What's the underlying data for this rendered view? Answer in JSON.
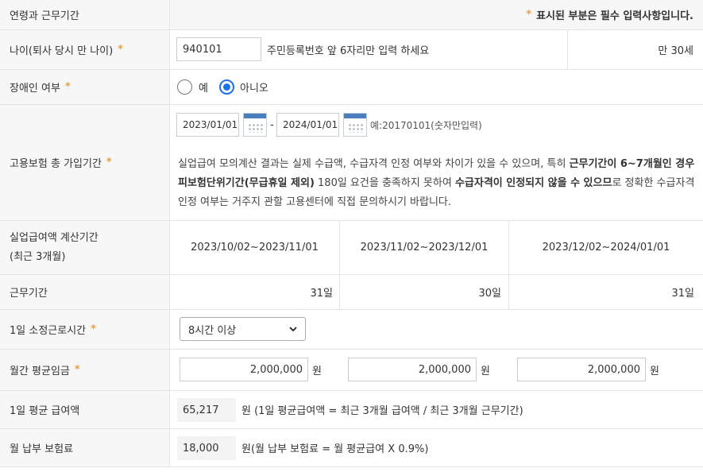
{
  "header": {
    "title": "연령과 근무기간",
    "required_note": "표시된 부분은 필수 입력사항입니다.",
    "star": "*"
  },
  "age": {
    "label": "나이(퇴사 당시 만 나이)",
    "value": "940101",
    "hint": "주민등록번호 앞 6자리만 입력 하세요",
    "result": "만 30세"
  },
  "disabled": {
    "label": "장애인 여부",
    "option_yes": "예",
    "option_no": "아니오",
    "selected": "아니오"
  },
  "insurance": {
    "label": "고용보험 총 가입기간",
    "start": "2023/01/01",
    "dash": "-",
    "end": "2024/01/01",
    "example": "예:20170101(숫자만입력)",
    "note_1": "실업급여 모의계산 결과는 실제 수급액, 수급자격 인정 여부와 차이가 있을 수 있으며, 특히 ",
    "note_bold_1": "근무기간이 6~7개월인 경우 피보험단위기간(무급휴일 제외)",
    "note_2": " 180일 요건을 충족하지 못하여 ",
    "note_bold_2": "수급자격이 인정되지 않을 수 있으므",
    "note_3": "로 정확한 수급자격 인정 여부는 거주지 관할 고용센터에 직접 문의하시기 바랍니다."
  },
  "period": {
    "label_line1": "실업급여액 계산기간",
    "label_line2": "(최근 3개월)",
    "ranges": [
      "2023/10/02~2023/11/01",
      "2023/11/02~2023/12/01",
      "2023/12/02~2024/01/01"
    ]
  },
  "workdays": {
    "label": "근무기간",
    "values": [
      "31일",
      "30일",
      "31일"
    ]
  },
  "hours": {
    "label": "1일 소정근로시간",
    "selected": "8시간 이상"
  },
  "wage": {
    "label": "월간 평균임금",
    "values": [
      "2,000,000",
      "2,000,000",
      "2,000,000"
    ],
    "unit": "원"
  },
  "daily_benefit": {
    "label": "1일 평균 급여액",
    "value": "65,217",
    "formula": "원 (1일 평균급여액 = 최근 3개월 급여액 / 최근 3개월 근무기간)"
  },
  "premium": {
    "label": "월 납부 보험료",
    "value": "18,000",
    "formula": "원(월 납부 보험료 = 월 평균급여 X 0.9%)"
  },
  "colors": {
    "accent_star": "#f0a033",
    "radio_active": "#1a73e8",
    "label_bg": "#f7f7f7",
    "border": "#e5e5e5"
  }
}
